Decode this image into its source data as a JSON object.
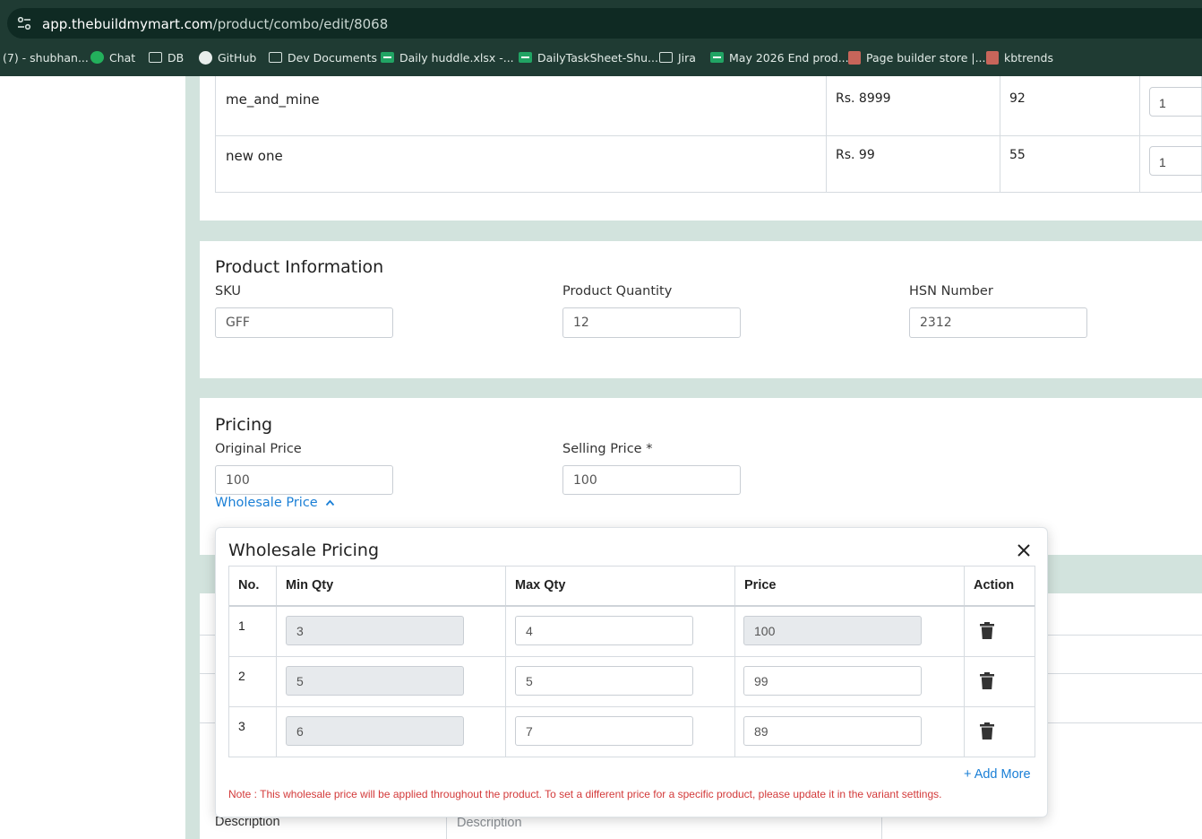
{
  "browser": {
    "url_domain": "app.thebuildmymart.com",
    "url_path": "/product/combo/edit/8068",
    "bookmarks": [
      {
        "label": "(7) - shubhan...",
        "icon": "none"
      },
      {
        "label": "Chat",
        "icon": "chat-icon"
      },
      {
        "label": "DB",
        "icon": "folder-icon"
      },
      {
        "label": "GitHub",
        "icon": "github-icon"
      },
      {
        "label": "Dev Documents",
        "icon": "folder-icon"
      },
      {
        "label": "Daily huddle.xlsx -...",
        "icon": "sheets-icon"
      },
      {
        "label": "DailyTaskSheet-Shu...",
        "icon": "sheets-icon"
      },
      {
        "label": "Jira",
        "icon": "folder-icon"
      },
      {
        "label": "May 2026 End prod...",
        "icon": "sheets-icon"
      },
      {
        "label": "Page builder store |...",
        "icon": "store-icon"
      },
      {
        "label": "kbtrends",
        "icon": "store-icon"
      }
    ]
  },
  "variants": {
    "rows": [
      {
        "name": "me_and_mine",
        "price": "Rs. 8999",
        "stock": "92",
        "qty": "1"
      },
      {
        "name": "new one",
        "price": "Rs. 99",
        "stock": "55",
        "qty": "1"
      }
    ]
  },
  "product_info": {
    "title": "Product Information",
    "sku_label": "SKU",
    "sku_value": "GFF",
    "qty_label": "Product Quantity",
    "qty_value": "12",
    "hsn_label": "HSN Number",
    "hsn_value": "2312"
  },
  "pricing": {
    "title": "Pricing",
    "original_label": "Original Price",
    "original_value": "100",
    "selling_label": "Selling Price *",
    "selling_value": "100",
    "wholesale_link": "Wholesale Price"
  },
  "description": {
    "label": "Description",
    "placeholder": "Description"
  },
  "wholesale_modal": {
    "title": "Wholesale Pricing",
    "headers": {
      "no": "No.",
      "min": "Min Qty",
      "max": "Max Qty",
      "price": "Price",
      "action": "Action"
    },
    "rows": [
      {
        "no": "1",
        "min": "3",
        "max": "4",
        "price": "100"
      },
      {
        "no": "2",
        "min": "5",
        "max": "5",
        "price": "99"
      },
      {
        "no": "3",
        "min": "6",
        "max": "7",
        "price": "89"
      }
    ],
    "add_more": "+ Add More",
    "note": "Note : This wholesale price will be applied throughout the product. To set a different price for a specific product, please update it in the variant settings."
  }
}
